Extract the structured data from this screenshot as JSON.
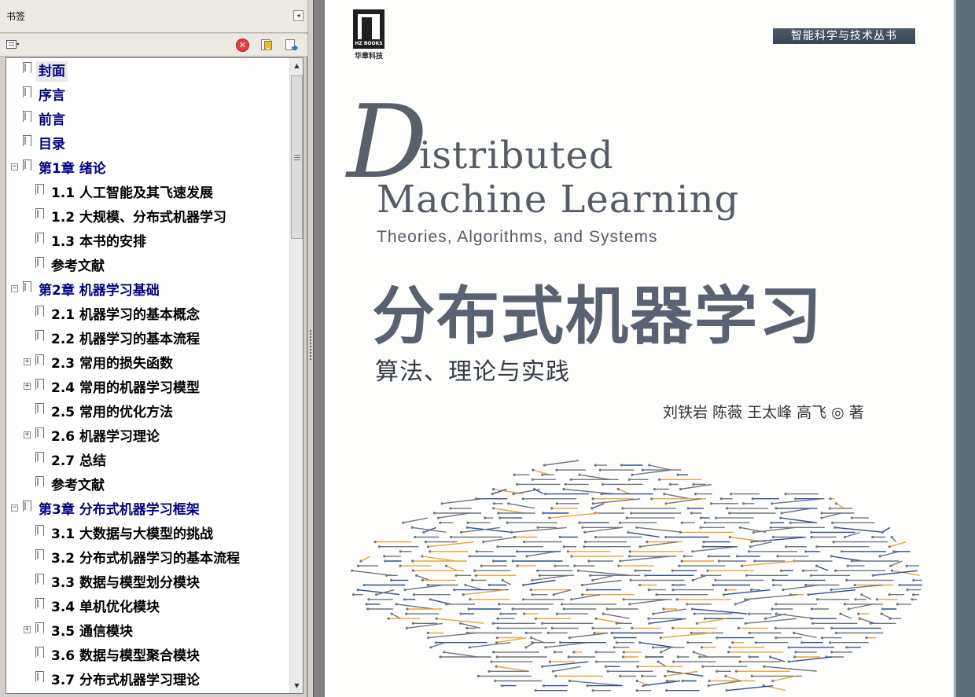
{
  "panel": {
    "title": "书签",
    "collapse_icon": "◂",
    "options_arrow": "▾",
    "delete_glyph": "✕"
  },
  "scrollbar": {
    "up": "▲",
    "down": "▼"
  },
  "bookmarks": [
    {
      "label": "封面",
      "level": 0
    },
    {
      "label": "序言",
      "level": 0
    },
    {
      "label": "前言",
      "level": 0
    },
    {
      "label": "目录",
      "level": 0
    },
    {
      "label": "第1章 绪论",
      "level": 0,
      "expander": "−"
    },
    {
      "label": "1.1 人工智能及其飞速发展",
      "level": 1
    },
    {
      "label": "1.2 大规模、分布式机器学习",
      "level": 1
    },
    {
      "label": "1.3 本书的安排",
      "level": 1
    },
    {
      "label": "参考文献",
      "level": 1
    },
    {
      "label": "第2章 机器学习基础",
      "level": 0,
      "expander": "−"
    },
    {
      "label": "2.1 机器学习的基本概念",
      "level": 1
    },
    {
      "label": "2.2 机器学习的基本流程",
      "level": 1
    },
    {
      "label": "2.3 常用的损失函数",
      "level": 1,
      "expander": "+"
    },
    {
      "label": "2.4 常用的机器学习模型",
      "level": 1,
      "expander": "+"
    },
    {
      "label": "2.5 常用的优化方法",
      "level": 1
    },
    {
      "label": "2.6 机器学习理论",
      "level": 1,
      "expander": "+"
    },
    {
      "label": "2.7 总结",
      "level": 1
    },
    {
      "label": "参考文献",
      "level": 1
    },
    {
      "label": "第3章 分布式机器学习框架",
      "level": 0,
      "expander": "−"
    },
    {
      "label": "3.1 大数据与大模型的挑战",
      "level": 1
    },
    {
      "label": "3.2 分布式机器学习的基本流程",
      "level": 1
    },
    {
      "label": "3.3 数据与模型划分模块",
      "level": 1
    },
    {
      "label": "3.4 单机优化模块",
      "level": 1
    },
    {
      "label": "3.5 通信模块",
      "level": 1,
      "expander": "+"
    },
    {
      "label": "3.6 数据与模型聚合模块",
      "level": 1
    },
    {
      "label": "3.7 分布式机器学习理论",
      "level": 1
    }
  ],
  "selected_bookmark": 0,
  "cover": {
    "publisher_logo_text": "HZ BOOKS",
    "publisher": "华章科技",
    "series": "智能科学与技术丛书",
    "title_initial": "D",
    "title_line1_rest": "istributed",
    "title_line2": "Machine Learning",
    "subtitle_en": "Theories, Algorithms, and Systems",
    "title_cn": "分布式机器学习",
    "subtitle_cn": "算法、理论与实践",
    "authors": "刘铁岩  陈薇  王太峰  高飞 ◎ 著"
  },
  "colors": {
    "chapter_text": "#000080",
    "circuit_gray": "#6f7681",
    "circuit_blue": "#2f4f9a",
    "circuit_orange": "#e6a53a"
  }
}
